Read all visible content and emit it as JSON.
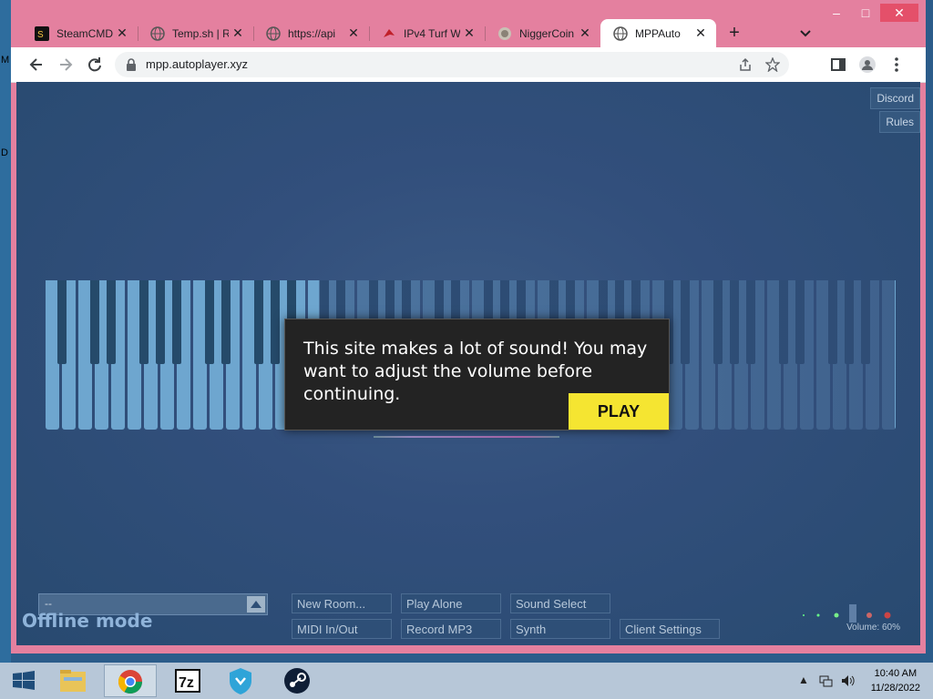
{
  "desktop": {
    "edge_letters": [
      "M",
      "D"
    ]
  },
  "browser": {
    "tabs": [
      {
        "label": "SteamCMD",
        "icon": "steamcmd-icon"
      },
      {
        "label": "Temp.sh | R",
        "icon": "globe-icon"
      },
      {
        "label": "https://api",
        "icon": "globe-icon"
      },
      {
        "label": "IPv4 Turf W",
        "icon": "turf-icon"
      },
      {
        "label": "NiggerCoin",
        "icon": "coin-icon"
      },
      {
        "label": "MPPAuto",
        "icon": "globe-icon",
        "active": true
      }
    ],
    "new_tab_symbol": "+",
    "window_controls": {
      "minimize": "–",
      "maximize": "□",
      "close": "✕"
    },
    "url": "mpp.autoplayer.xyz"
  },
  "page": {
    "top_buttons": {
      "discord": "Discord",
      "rules": "Rules"
    },
    "modal": {
      "message": "This site makes a lot of sound! You may want to adjust the volume before continuing.",
      "play_label": "PLAY"
    },
    "room_select_value": "--",
    "status": "Offline mode",
    "buttons": {
      "new_room": "New Room...",
      "play_alone": "Play Alone",
      "sound_select": "Sound Select",
      "midi": "MIDI In/Out",
      "record": "Record MP3",
      "synth": "Synth",
      "client_settings": "Client Settings"
    },
    "volume_label": "Volume: 60%",
    "volume": 0.6
  },
  "taskbar": {
    "apps": [
      "start-icon",
      "file-explorer-icon",
      "chrome-icon",
      "7zip-icon",
      "shield-app-icon",
      "steam-icon"
    ],
    "time": "10:40 AM",
    "date": "11/28/2022"
  },
  "colors": {
    "frame": "#e4809f",
    "page_bg": "#324f7c",
    "play_button": "#f5e531",
    "piano_white": "#6ea6cf"
  }
}
